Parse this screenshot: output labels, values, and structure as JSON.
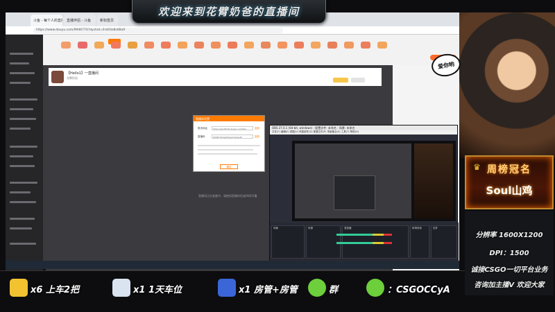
{
  "banner": {
    "title": "欢迎来到花臂奶爸的直播间"
  },
  "browser": {
    "tabs": [
      "斗鱼 - 每个人的直播平台",
      "直播伴侣 - 斗鱼",
      "新标签页"
    ],
    "url": "https://www.douyu.com/9946774?dyshid=0-b93e8c88a9"
  },
  "room": {
    "title": "【Hello1】一直播间",
    "subtitle": "花臂奶爸"
  },
  "dialog": {
    "title": "直播间设置",
    "label_addr": "推流地址",
    "label_code": "直播码",
    "addr_value": "rtmp://sendtc3a.douyu.com/live",
    "code_value": "9946774rkgzfmgv1?wsAuth",
    "copy": "复制",
    "confirm": "确定"
  },
  "content_hint": "直播间正在准备中，请使用直播伴侣或OBS开播",
  "obs": {
    "title": "OBS 27.0.1 (64-bit, windows) - 配置文件: 未命名 - 场景: 未命名",
    "menu": "文件(F)  编辑(E)  视图(V)  停靠部件(D)  配置文件(P)  场景集合(S)  工具(T)  帮助(H)",
    "dock_scenes": "场景",
    "dock_sources": "来源",
    "dock_mixer": "混音器",
    "dock_transitions": "转场特效",
    "dock_controls": "控件"
  },
  "avatar_bubble": "爱你哟",
  "crown": {
    "title": "周榜冠名",
    "name": "Soul山鸡"
  },
  "info": {
    "resolution": "分辨率 1600X1200",
    "dpi": "DPI：1500",
    "line1": "诚接CSGO一切平台业务",
    "line2": "咨询加主播V  欢迎大家"
  },
  "bottom": [
    {
      "icon": "ticket-icon",
      "text": "x6 上车2把",
      "color": "#f2c230"
    },
    {
      "icon": "rocket-plane-icon",
      "text": "x1 1天车位",
      "color": "#d9e4f0"
    },
    {
      "icon": "rocket-icon",
      "text": "x1 房管+房管",
      "color": "#3a66d8"
    },
    {
      "icon": "wechat-icon",
      "text": "群",
      "color": "#6ccf3b"
    },
    {
      "icon": "wechat-icon",
      "text": "：CSGOCCyA",
      "color": "#6ccf3b"
    }
  ]
}
